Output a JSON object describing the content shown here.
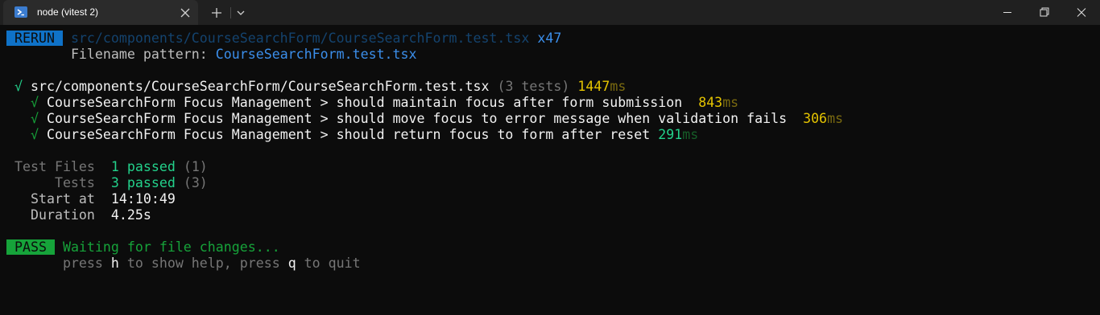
{
  "window": {
    "tab_title": "node (vitest 2)",
    "icons": {
      "tab": "powershell-icon",
      "close": "close-icon",
      "new_tab": "plus-icon",
      "dropdown": "chevron-down-icon",
      "minimize": "minimize-icon",
      "maximize": "restore-icon",
      "close_window": "close-icon"
    }
  },
  "terminal": {
    "rerun_badge": " RERUN ",
    "rerun_file": "src/components/CourseSearchForm/CourseSearchForm.test.tsx",
    "rerun_count": "x47",
    "filename_pattern_label": "Filename pattern: ",
    "filename_pattern_value": "CourseSearchForm.test.tsx",
    "suite": {
      "check": "√",
      "path": "src/components/CourseSearchForm/CourseSearchForm.test.tsx",
      "count": "(3 tests)",
      "time": "1447",
      "unit": "ms"
    },
    "tests": [
      {
        "check": "√",
        "name": "CourseSearchForm Focus Management > should maintain focus after form submission",
        "time": "843",
        "unit": "ms"
      },
      {
        "check": "√",
        "name": "CourseSearchForm Focus Management > should move focus to error message when validation fails",
        "time": "306",
        "unit": "ms"
      },
      {
        "check": "√",
        "name": "CourseSearchForm Focus Management > should return focus to form after reset",
        "time": "291",
        "unit": "ms"
      }
    ],
    "summary": {
      "test_files_label": "Test Files",
      "test_files_value": "1 passed",
      "test_files_total": "(1)",
      "tests_label": "Tests",
      "tests_value": "3 passed",
      "tests_total": "(3)",
      "start_label": "Start at",
      "start_value": "14:10:49",
      "duration_label": "Duration",
      "duration_value": "4.25s"
    },
    "pass_badge": " PASS ",
    "waiting": "Waiting for file changes...",
    "help_press": "press ",
    "help_h": "h",
    "help_mid": " to show help, press ",
    "help_q": "q",
    "help_end": " to quit"
  },
  "colors": {
    "background": "#0c0c0c",
    "titlebar": "#202020",
    "rerun_badge": "#0f72c8",
    "pass_badge": "#16a33a",
    "passed_text": "#23d18b",
    "duration_yellow": "#e5c400"
  }
}
